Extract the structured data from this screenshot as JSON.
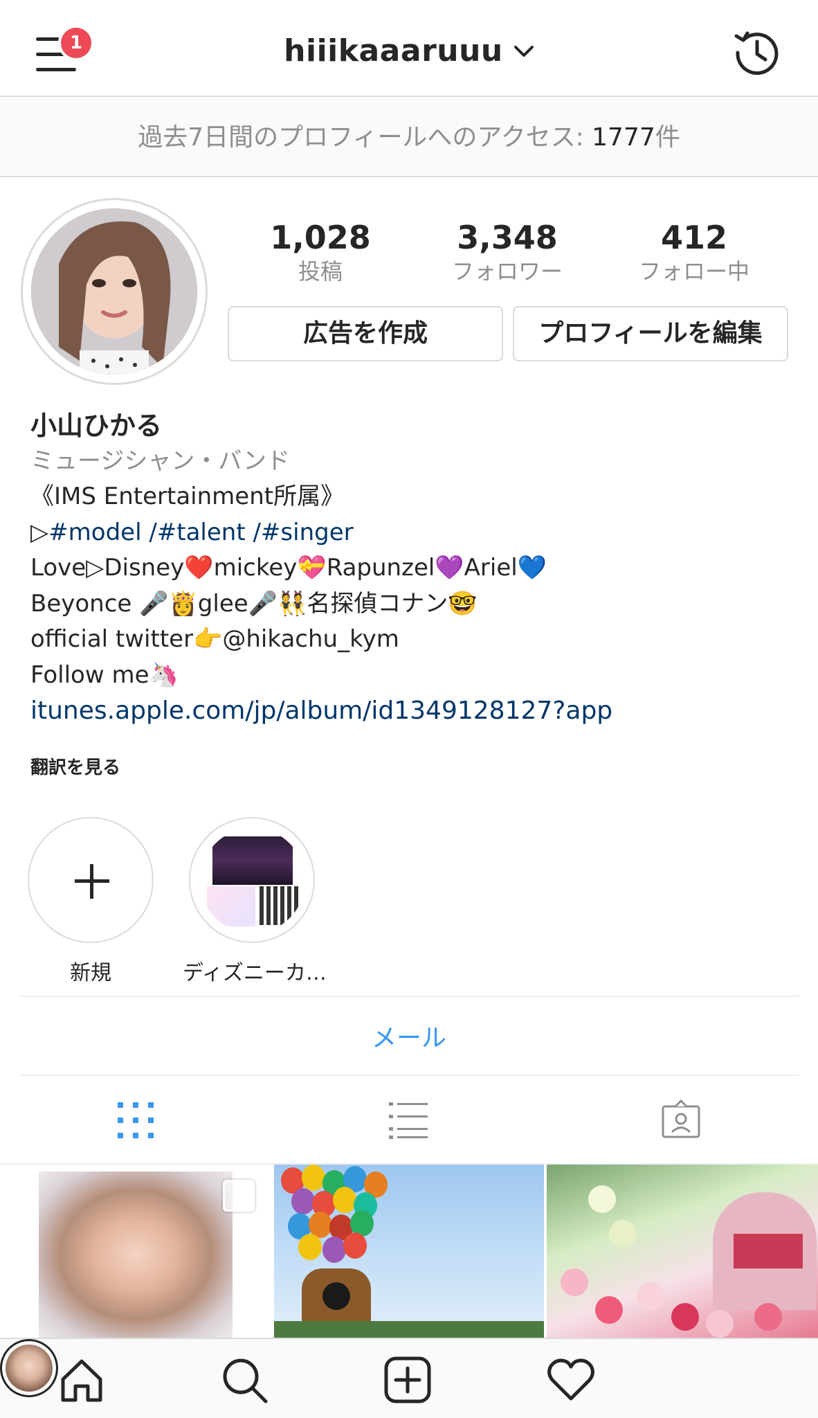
{
  "header": {
    "username": "hiiikaaaruuu",
    "notification_count": "1"
  },
  "insights": {
    "label": "過去7日間のプロフィールへのアクセス: ",
    "count": "1777",
    "unit": "件"
  },
  "stats": {
    "posts": {
      "value": "1,028",
      "label": "投稿"
    },
    "followers": {
      "value": "3,348",
      "label": "フォロワー"
    },
    "following": {
      "value": "412",
      "label": "フォロー中"
    }
  },
  "buttons": {
    "create_ad": "広告を作成",
    "edit_profile": "プロフィールを編集"
  },
  "bio": {
    "name": "小山ひかる",
    "category": "ミュージシャン・バンド",
    "line1": "《IMS Entertainment所属》",
    "line2_prefix": "▷",
    "line2_tags": "#model /#talent /#singer",
    "line3": "Love▷Disney❤️mickey💝Rapunzel💜Ariel💙",
    "line4": "Beyonce 🎤👸glee🎤👯名探偵コナン🤓",
    "line5": "official twitter👉@hikachu_kym",
    "line6": "Follow me🦄",
    "link": "itunes.apple.com/jp/album/id1349128127?app",
    "see_translation": "翻訳を見る"
  },
  "highlights": [
    {
      "label": "新規"
    },
    {
      "label": "ディズニーカ…"
    }
  ],
  "contact": {
    "mail": "メール"
  },
  "icons": {
    "menu": "menu-icon",
    "dropdown": "chevron-down-icon",
    "history": "history-icon",
    "grid": "grid-icon",
    "list": "list-icon",
    "tagged": "tagged-icon",
    "home": "home-icon",
    "search": "search-icon",
    "add": "add-icon",
    "activity": "heart-icon"
  },
  "colors": {
    "link": "#003569",
    "accent": "#3897f0",
    "badge": "#ed4956",
    "muted": "#8e8e8e"
  }
}
